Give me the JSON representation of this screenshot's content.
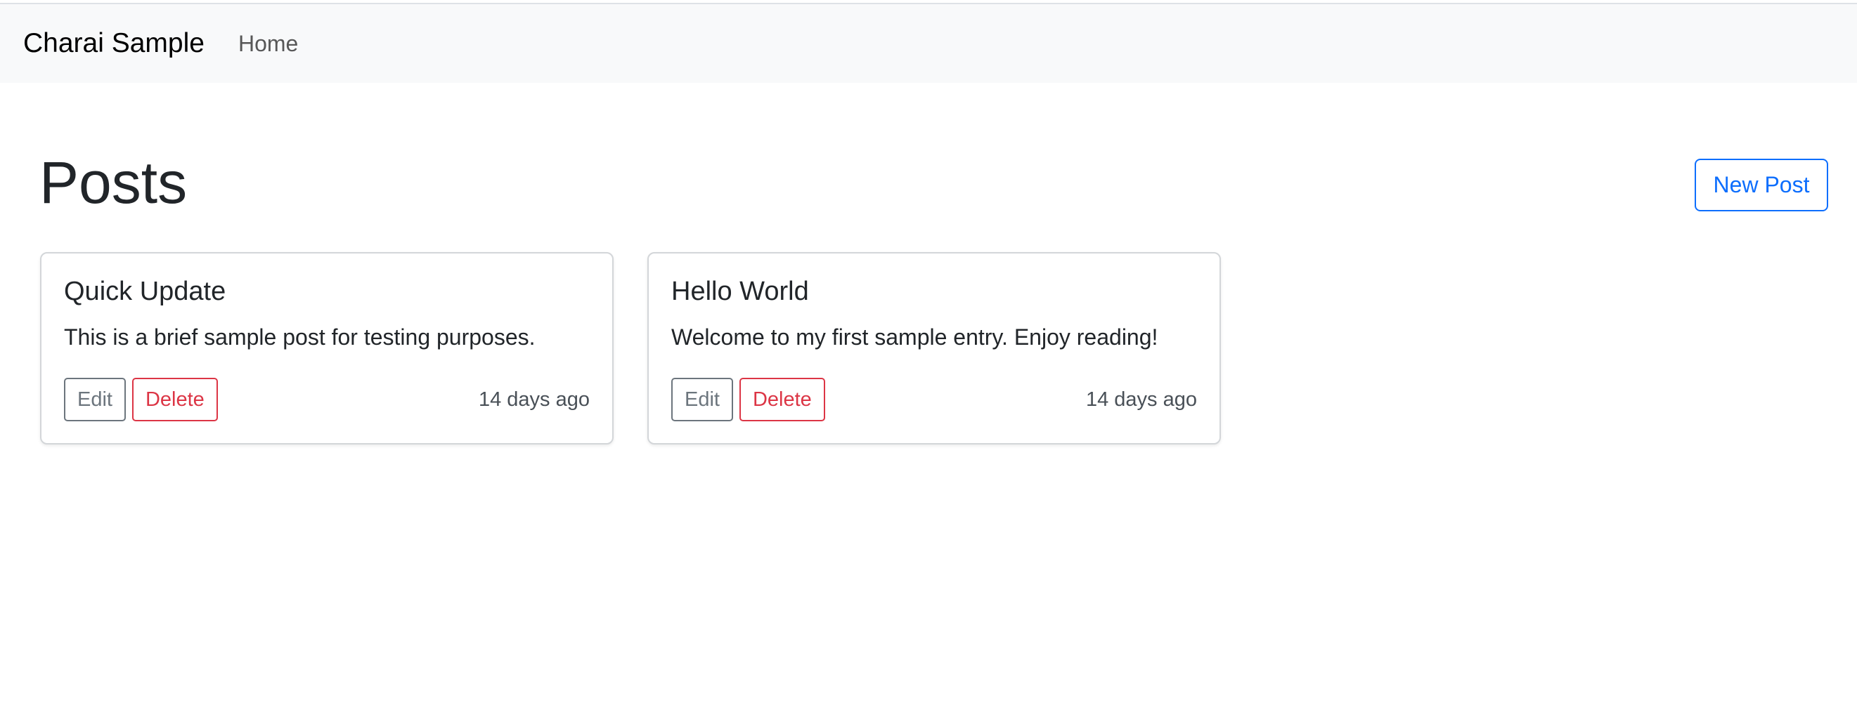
{
  "navbar": {
    "brand": "Charai Sample",
    "links": [
      {
        "label": "Home"
      }
    ]
  },
  "page": {
    "title": "Posts",
    "new_post_label": "New Post"
  },
  "posts": [
    {
      "title": "Quick Update",
      "body": "This is a brief sample post for testing purposes.",
      "edit_label": "Edit",
      "delete_label": "Delete",
      "time": "14 days ago"
    },
    {
      "title": "Hello World",
      "body": "Welcome to my first sample entry. Enjoy reading!",
      "edit_label": "Edit",
      "delete_label": "Delete",
      "time": "14 days ago"
    }
  ],
  "colors": {
    "primary": "#0d6efd",
    "secondary": "#6c757d",
    "danger": "#dc3545",
    "navbar_bg": "#f8f9fa"
  }
}
